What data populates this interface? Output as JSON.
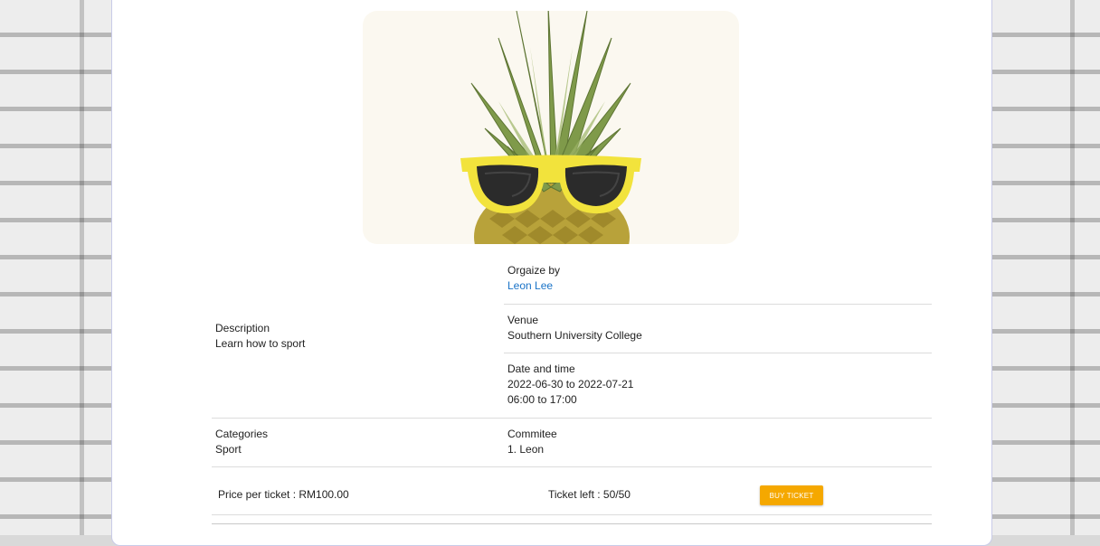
{
  "event": {
    "organize_label": "Orgaize by",
    "organizer": "Leon Lee",
    "venue_label": "Venue",
    "venue": "Southern University College",
    "datetime_label": "Date and time",
    "date_range": "2022-06-30 to 2022-07-21",
    "time_range": "06:00 to 17:00",
    "description_label": "Description",
    "description": "Learn how to sport",
    "categories_label": "Categories",
    "category": "Sport",
    "committee_label": "Commitee",
    "committee_member": "1. Leon"
  },
  "ticket": {
    "price_text": "Price per ticket : RM100.00",
    "left_text": "Ticket left : 50/50",
    "buy_label": "BUY TICKET"
  },
  "colors": {
    "accent": "#f5a800",
    "link": "#1a73c7",
    "hero_bg": "#fbf8f0"
  }
}
